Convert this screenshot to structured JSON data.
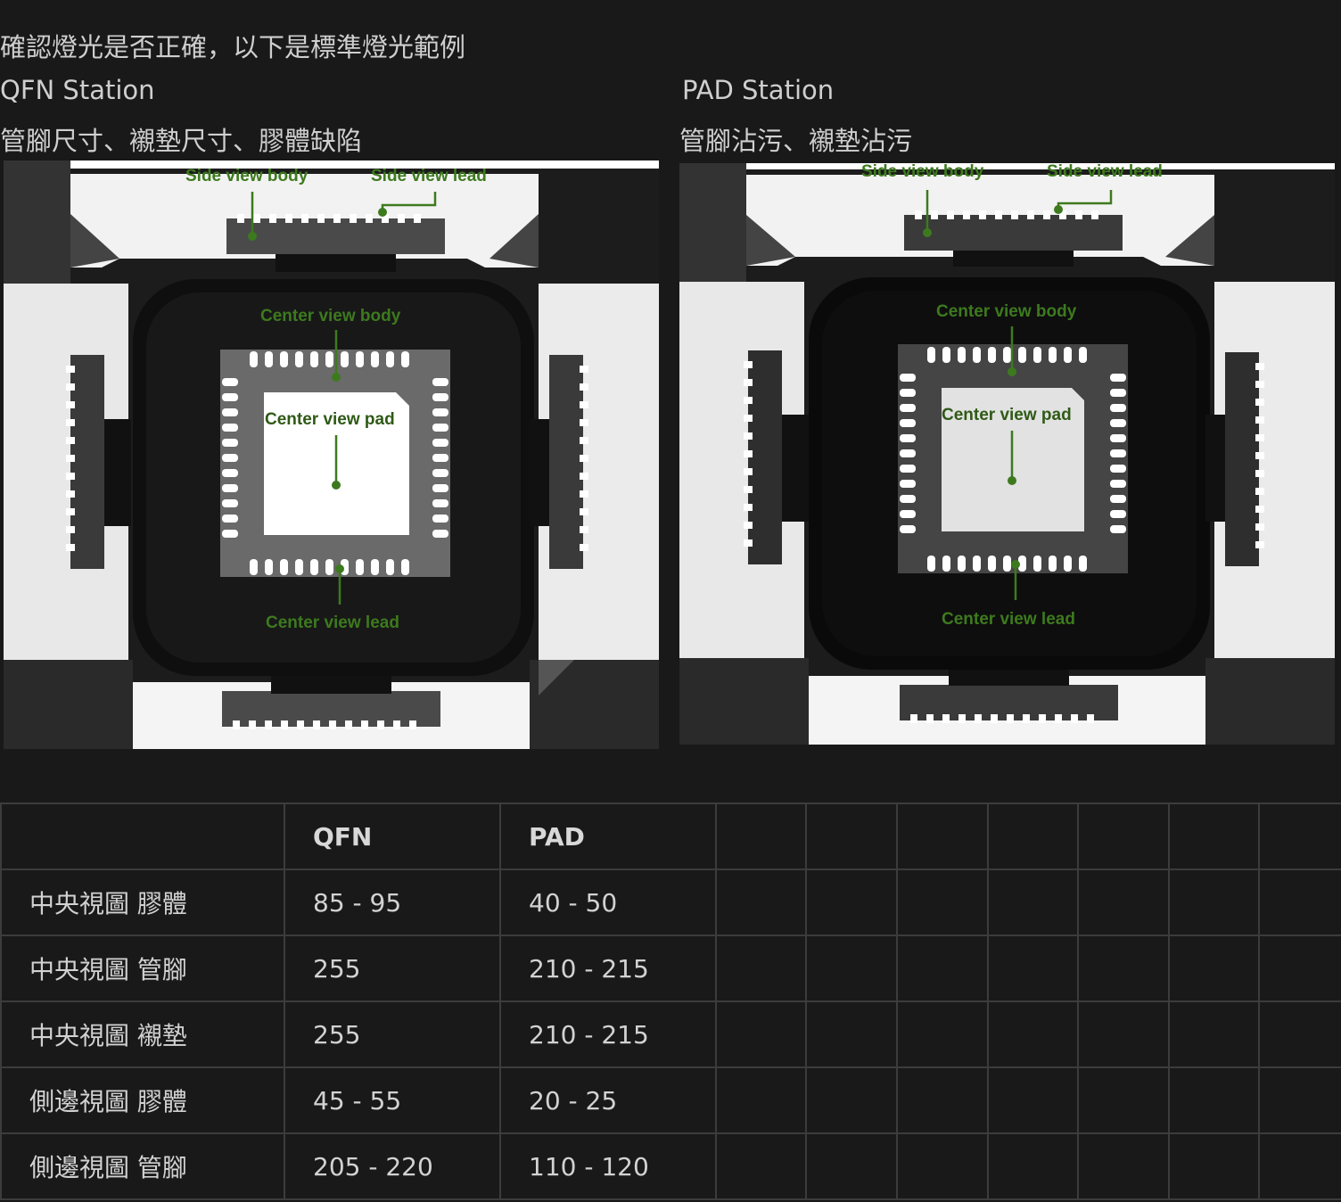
{
  "intro_text": "確認燈光是否正確，以下是標準燈光範例",
  "stations": [
    {
      "title": "QFN Station",
      "description": "管腳尺寸、襯墊尺寸、膠體缺陷",
      "annotations": {
        "side_body": "Side view body",
        "side_lead": "Side view lead",
        "center_body": "Center view body",
        "center_pad": "Center view pad",
        "center_lead": "Center view lead"
      }
    },
    {
      "title": "PAD Station",
      "description": "管腳沾污、襯墊沾污",
      "annotations": {
        "side_body": "Side view body",
        "side_lead": "Side view lead",
        "center_body": "Center view body",
        "center_pad": "Center view pad",
        "center_lead": "Center view lead"
      }
    }
  ],
  "annotation_color": "#3d7a1e",
  "table": {
    "headers": [
      "",
      "QFN",
      "PAD"
    ],
    "rows": [
      [
        "中央視圖 膠體",
        "85 - 95",
        "40 - 50"
      ],
      [
        "中央視圖 管腳",
        "255",
        "210 - 215"
      ],
      [
        "中央視圖 襯墊",
        "255",
        "210 - 215"
      ],
      [
        "側邊視圖 膠體",
        "45 - 55",
        "20 - 25"
      ],
      [
        "側邊視圖 管腳",
        "205 - 220",
        "110 - 120"
      ]
    ]
  }
}
